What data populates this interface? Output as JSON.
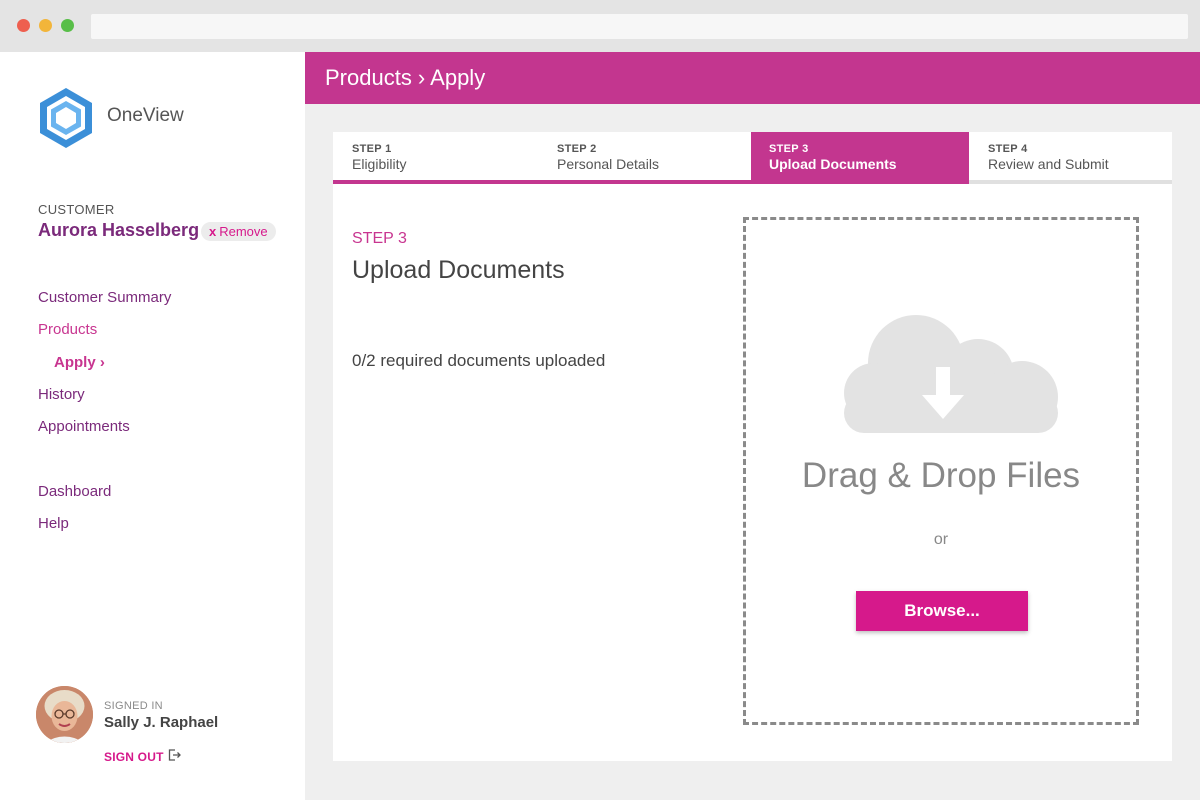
{
  "app": {
    "brand": "OneView"
  },
  "colors": {
    "accent": "#c3368f",
    "link": "#7b2a7b",
    "button": "#d6198b"
  },
  "customer": {
    "label": "CUSTOMER",
    "name": "Aurora Hasselberg",
    "remove_icon": "x",
    "remove_label": "Remove"
  },
  "nav": {
    "items": [
      {
        "label": "Customer Summary"
      },
      {
        "label": "Products"
      },
      {
        "label": "Apply ›"
      },
      {
        "label": "History"
      },
      {
        "label": "Appointments"
      },
      {
        "label": "Dashboard"
      },
      {
        "label": "Help"
      }
    ]
  },
  "user": {
    "signed_label": "SIGNED IN",
    "name": "Sally J. Raphael",
    "signout_label": "SIGN OUT",
    "signout_icon": "sign-out-icon"
  },
  "header": {
    "breadcrumb": "Products › Apply"
  },
  "steps": [
    {
      "num": "STEP 1",
      "label": "Eligibility"
    },
    {
      "num": "STEP 2",
      "label": "Personal Details"
    },
    {
      "num": "STEP 3",
      "label": "Upload Documents"
    },
    {
      "num": "STEP 4",
      "label": "Review and Submit"
    }
  ],
  "current_step": 3,
  "section": {
    "step": "STEP 3",
    "title": "Upload Documents",
    "status": "0/2 required documents uploaded"
  },
  "dropzone": {
    "icon": "cloud-download-icon",
    "title": "Drag & Drop Files",
    "or": "or",
    "browse_label": "Browse..."
  }
}
